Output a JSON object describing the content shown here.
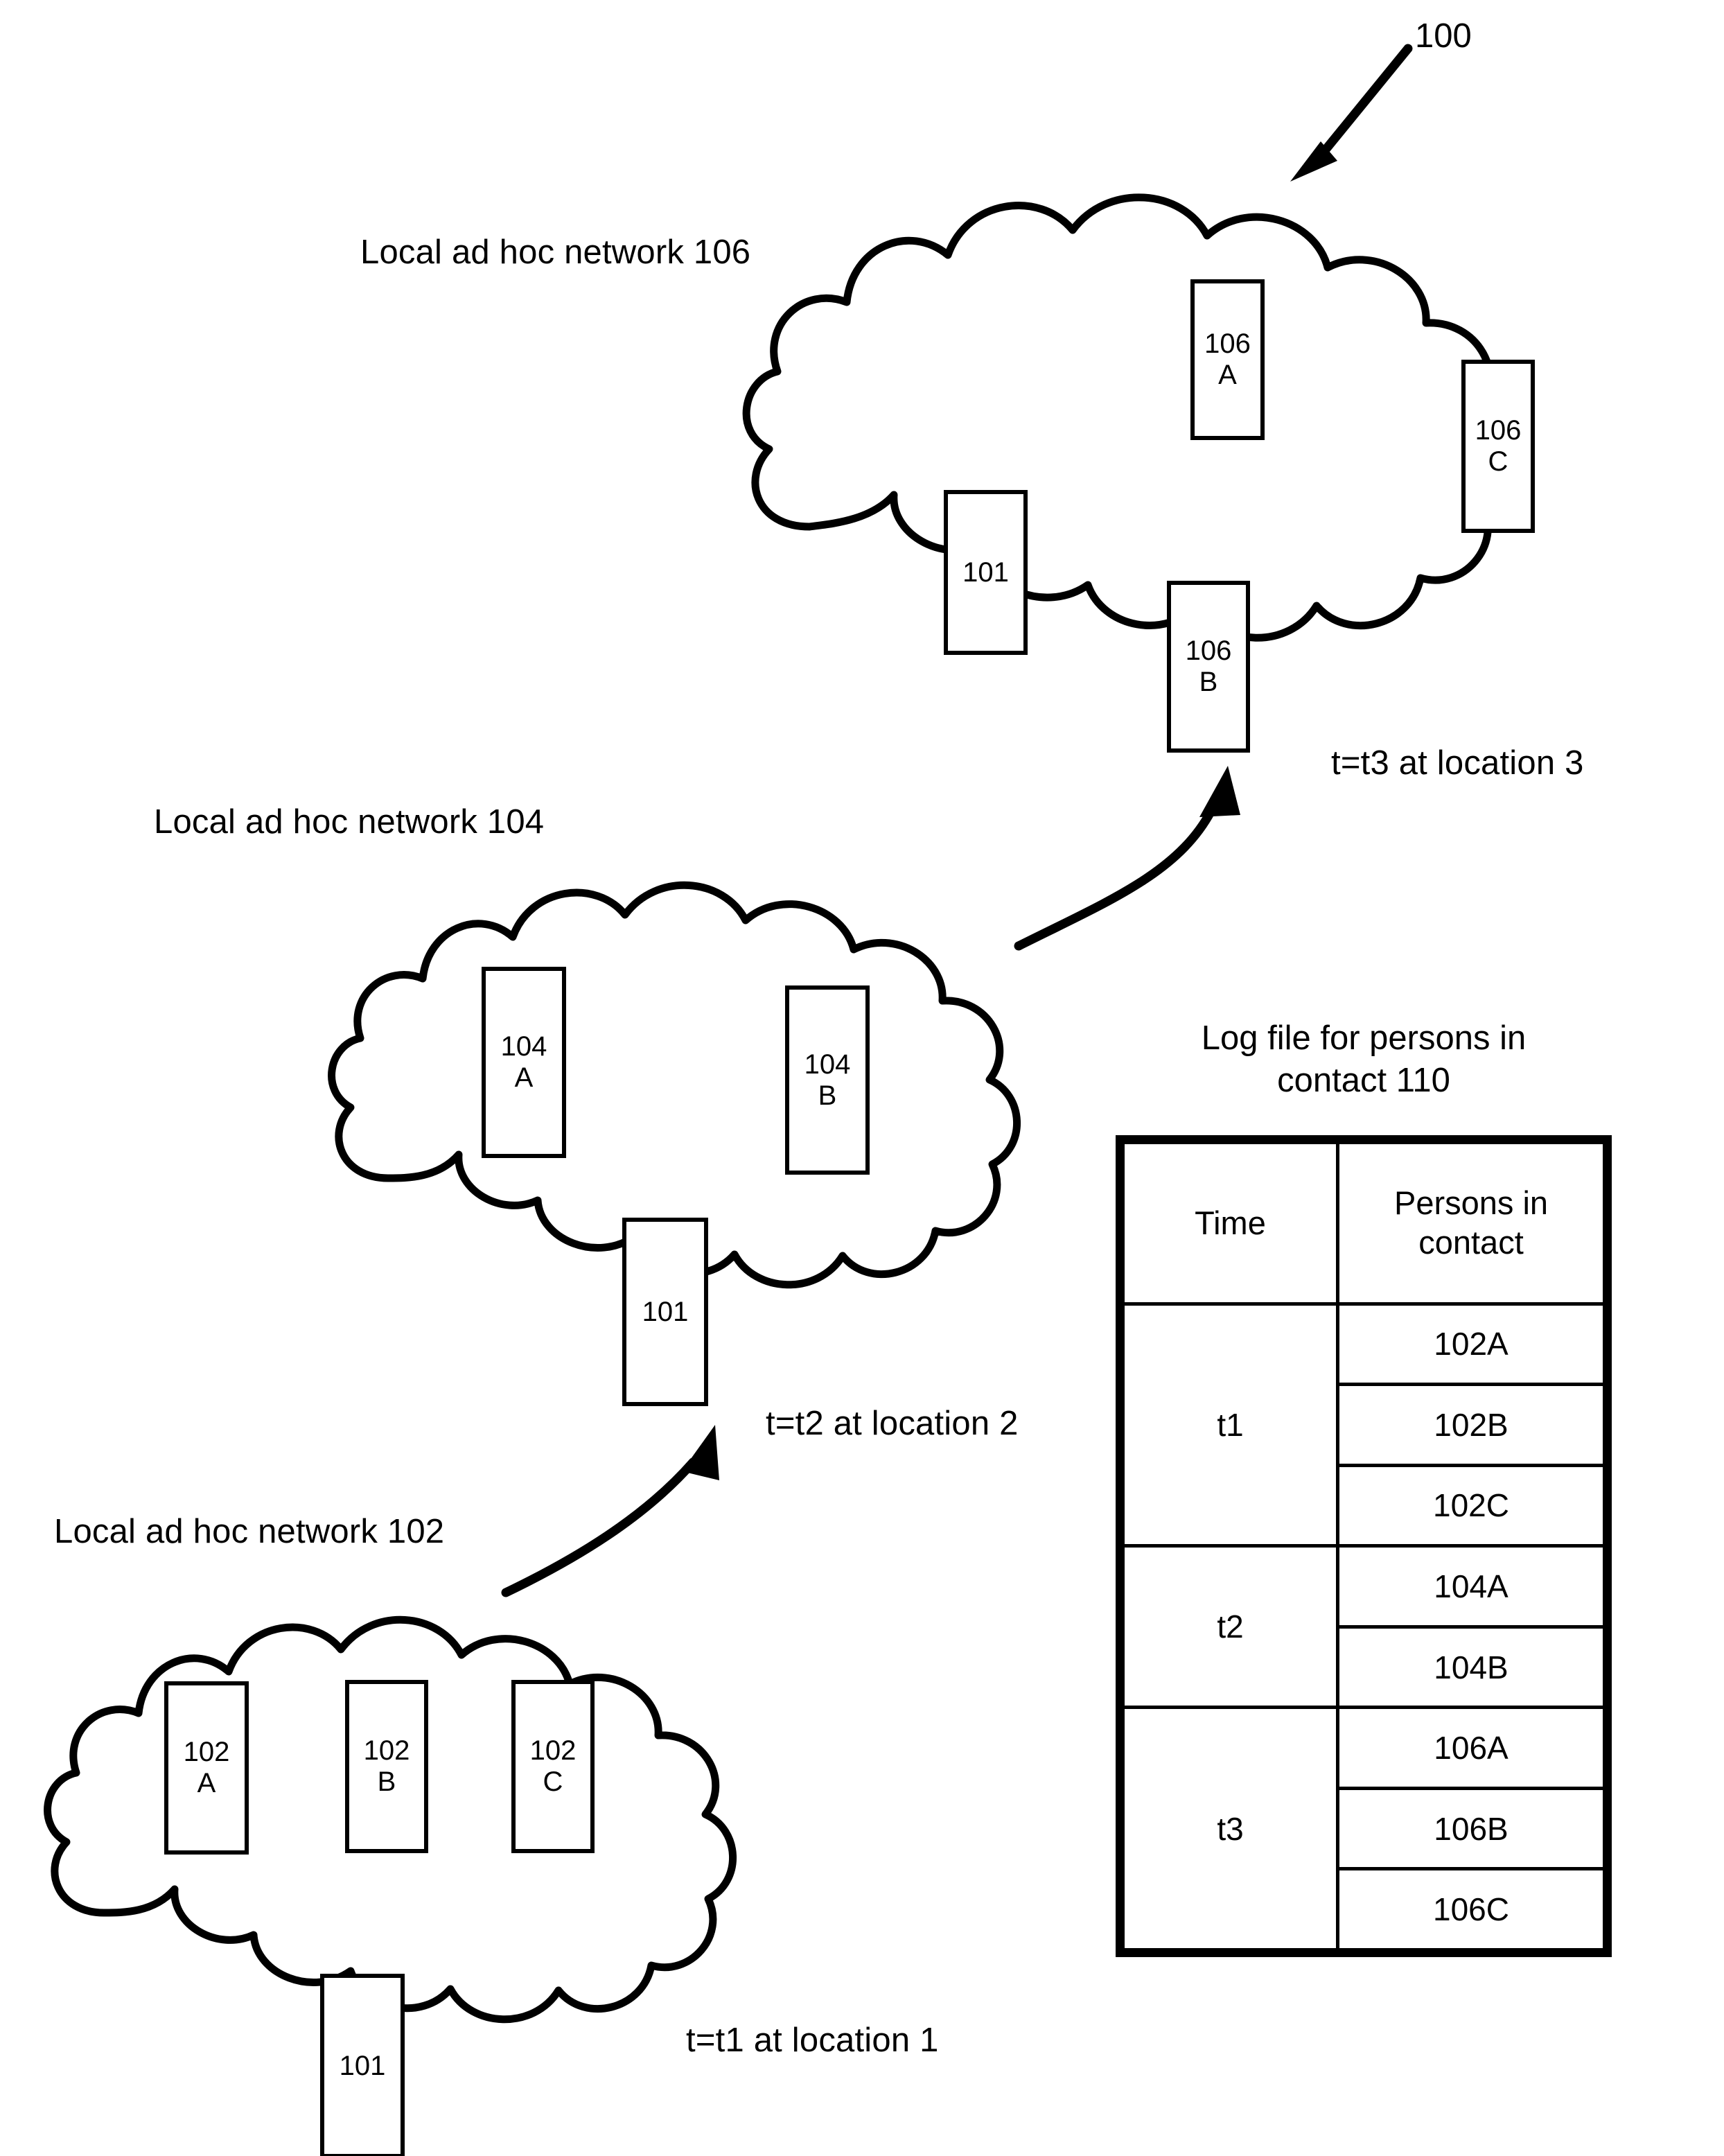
{
  "figure": {
    "ref_label": "100"
  },
  "networks": [
    {
      "id": "net106",
      "label": "Local ad hoc network 106",
      "caption": "t=t3 at location 3",
      "nodes": [
        {
          "line1": "106",
          "line2": "A"
        },
        {
          "line1": "106",
          "line2": "C"
        },
        {
          "line1": "101",
          "line2": ""
        },
        {
          "line1": "106",
          "line2": "B"
        }
      ]
    },
    {
      "id": "net104",
      "label": "Local ad hoc network 104",
      "caption": "t=t2 at location 2",
      "nodes": [
        {
          "line1": "104",
          "line2": "A"
        },
        {
          "line1": "104",
          "line2": "B"
        },
        {
          "line1": "101",
          "line2": ""
        }
      ]
    },
    {
      "id": "net102",
      "label": "Local ad hoc network 102",
      "caption": "t=t1 at location 1",
      "nodes": [
        {
          "line1": "102",
          "line2": "A"
        },
        {
          "line1": "102",
          "line2": "B"
        },
        {
          "line1": "102",
          "line2": "C"
        },
        {
          "line1": "101",
          "line2": ""
        }
      ]
    }
  ],
  "log_table": {
    "caption_line1": "Log file for persons in",
    "caption_line2": "contact 110",
    "headers": {
      "time": "Time",
      "persons_line1": "Persons in",
      "persons_line2": "contact"
    },
    "rows": [
      {
        "time": "t1",
        "persons": [
          "102A",
          "102B",
          "102C"
        ]
      },
      {
        "time": "t2",
        "persons": [
          "104A",
          "104B"
        ]
      },
      {
        "time": "t3",
        "persons": [
          "106A",
          "106B",
          "106C"
        ]
      }
    ]
  },
  "colors": {
    "ink": "#000000",
    "paper": "#ffffff"
  }
}
